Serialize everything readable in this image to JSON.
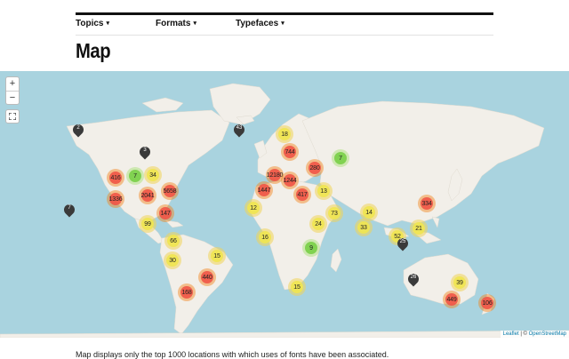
{
  "nav": {
    "items": [
      {
        "label": "Topics",
        "caret": "▾"
      },
      {
        "label": "Formats",
        "caret": "▾"
      },
      {
        "label": "Typefaces",
        "caret": "▾"
      }
    ]
  },
  "page_title": "Map",
  "map": {
    "zoom_in": "+",
    "zoom_out": "−",
    "clusters": [
      {
        "label": "416",
        "level": "large"
      },
      {
        "label": "7",
        "level": "small"
      },
      {
        "label": "34",
        "level": "medium"
      },
      {
        "label": "1336",
        "level": "large"
      },
      {
        "label": "2041",
        "level": "large"
      },
      {
        "label": "5658",
        "level": "large"
      },
      {
        "label": "147",
        "level": "large"
      },
      {
        "label": "99",
        "level": "medium"
      },
      {
        "label": "66",
        "level": "medium"
      },
      {
        "label": "15",
        "level": "medium"
      },
      {
        "label": "30",
        "level": "medium"
      },
      {
        "label": "440",
        "level": "large"
      },
      {
        "label": "168",
        "level": "large"
      },
      {
        "label": "18",
        "level": "medium"
      },
      {
        "label": "744",
        "level": "large"
      },
      {
        "label": "280",
        "level": "large"
      },
      {
        "label": "7",
        "level": "small"
      },
      {
        "label": "12180",
        "level": "large"
      },
      {
        "label": "1244",
        "level": "large"
      },
      {
        "label": "1447",
        "level": "large"
      },
      {
        "label": "417",
        "level": "large"
      },
      {
        "label": "13",
        "level": "medium"
      },
      {
        "label": "12",
        "level": "medium"
      },
      {
        "label": "73",
        "level": "medium"
      },
      {
        "label": "24",
        "level": "medium"
      },
      {
        "label": "16",
        "level": "medium"
      },
      {
        "label": "9",
        "level": "small"
      },
      {
        "label": "15",
        "level": "medium"
      },
      {
        "label": "14",
        "level": "medium"
      },
      {
        "label": "33",
        "level": "medium"
      },
      {
        "label": "334",
        "level": "large"
      },
      {
        "label": "21",
        "level": "medium"
      },
      {
        "label": "52",
        "level": "medium"
      },
      {
        "label": "39",
        "level": "medium"
      },
      {
        "label": "449",
        "level": "large"
      },
      {
        "label": "106",
        "level": "large"
      }
    ],
    "pins": [
      "2",
      "3",
      "43",
      "7",
      "25",
      "26"
    ],
    "attribution": {
      "leaflet": "Leaflet",
      "separator": "|",
      "copyright": "©",
      "osm": "OpenStreetMap"
    }
  },
  "footnote": "Map displays only the top 1000 locations with which uses of fonts have been associated."
}
